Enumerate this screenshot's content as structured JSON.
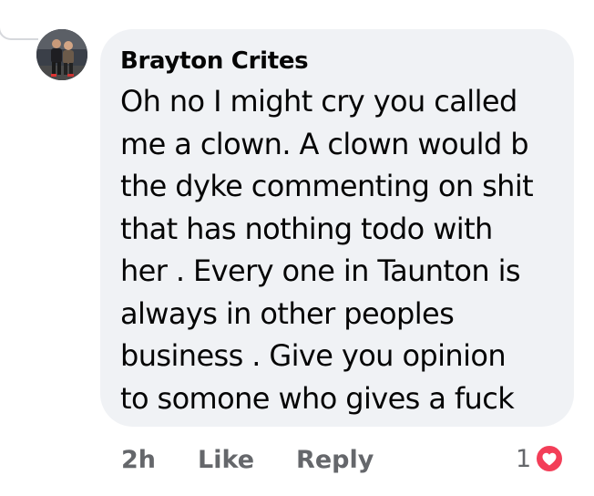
{
  "comment": {
    "author": "Brayton Crites",
    "text_lines": [
      "Oh no I might cry you called",
      "me a clown. A clown would b",
      "the dyke commenting on shit",
      "that has nothing todo with",
      "her . Every one in Taunton is",
      "always in other peoples",
      "business . Give you opinion",
      "to somone who gives a fuck"
    ],
    "avatar_icon": "profile-photo-two-people",
    "bubble_color": "#f0f2f5",
    "reaction_color": "#f33e58"
  },
  "actions": {
    "time": "2h",
    "like_label": "Like",
    "reply_label": "Reply"
  },
  "reactions": {
    "count": "1",
    "icon": "love-heart-icon"
  }
}
